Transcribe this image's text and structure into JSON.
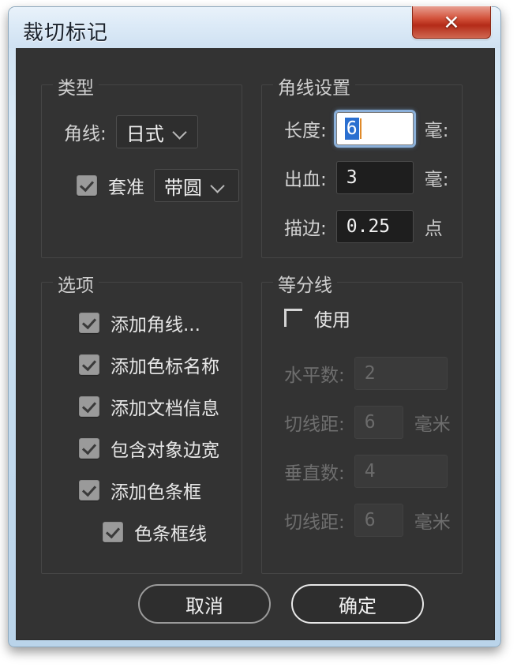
{
  "window": {
    "title": "裁切标记",
    "close_label": "✕",
    "accent_red": "#b42b18",
    "panel_bg": "#333333",
    "frame_blue": "#cfe2f3"
  },
  "type_group": {
    "legend": "类型",
    "corner_label": "角线:",
    "corner_value": "日式",
    "registration_label": "套准",
    "registration_checked": true,
    "registration_value": "带圆"
  },
  "corner_settings_group": {
    "legend": "角线设置",
    "rows": [
      {
        "label": "长度:",
        "value": "6",
        "unit": "毫:"
      },
      {
        "label": "出血:",
        "value": "3",
        "unit": "毫:"
      },
      {
        "label": "描边:",
        "value": "0.25",
        "unit": "点"
      }
    ]
  },
  "options_group": {
    "legend": "选项",
    "items": [
      {
        "label": "添加角线...",
        "checked": true,
        "indent": false
      },
      {
        "label": "添加色标名称",
        "checked": true,
        "indent": false
      },
      {
        "label": "添加文档信息",
        "checked": true,
        "indent": false
      },
      {
        "label": "包含对象边宽",
        "checked": true,
        "indent": false
      },
      {
        "label": "添加色条框",
        "checked": true,
        "indent": false
      },
      {
        "label": "色条框线",
        "checked": true,
        "indent": true
      }
    ]
  },
  "divider_group": {
    "legend": "等分线",
    "use_label": "使用",
    "use_checked": false,
    "rows": [
      {
        "label": "水平数:",
        "value": "2",
        "unit": ""
      },
      {
        "label": "切线距:",
        "value": "6",
        "unit": "毫米"
      },
      {
        "label": "垂直数:",
        "value": "4",
        "unit": ""
      },
      {
        "label": "切线距:",
        "value": "6",
        "unit": "毫米"
      }
    ]
  },
  "footer": {
    "cancel_label": "取消",
    "ok_label": "确定"
  }
}
